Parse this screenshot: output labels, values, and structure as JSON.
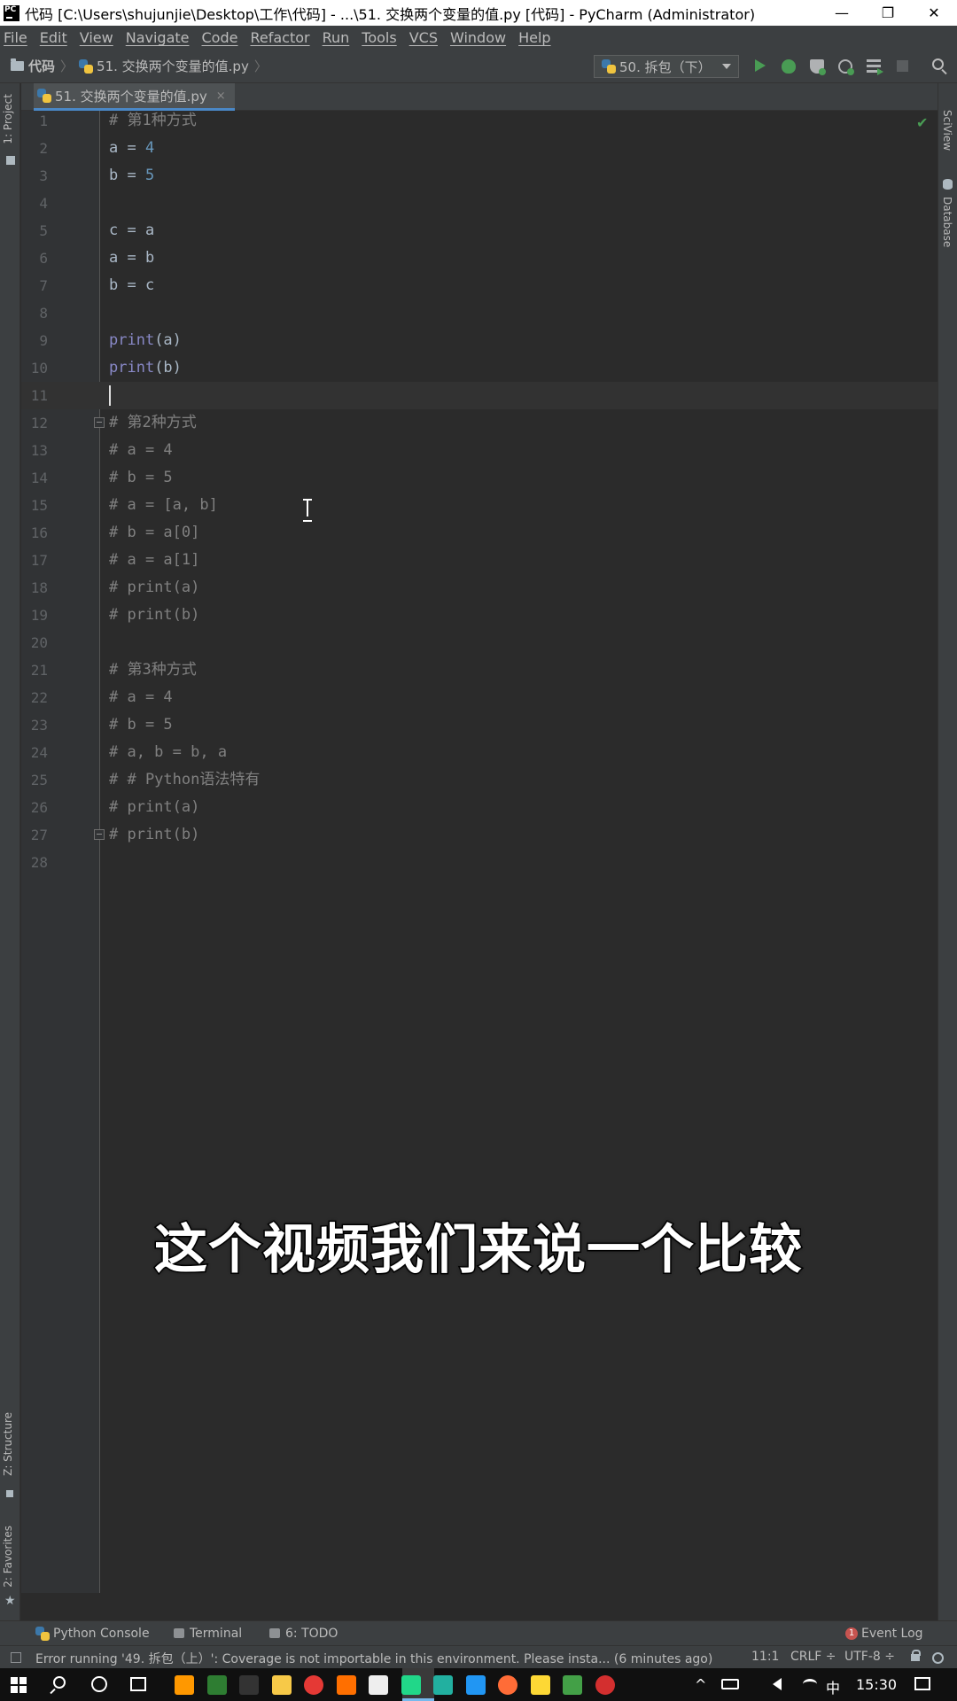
{
  "window": {
    "title": "代码 [C:\\Users\\shujunjie\\Desktop\\工作\\代码] - ...\\51. 交换两个变量的值.py [代码] - PyCharm (Administrator)",
    "app_icon_text": "PC",
    "minimize": "—",
    "restore": "❐",
    "close": "✕"
  },
  "menu": [
    "File",
    "Edit",
    "View",
    "Navigate",
    "Code",
    "Refactor",
    "Run",
    "Tools",
    "VCS",
    "Window",
    "Help"
  ],
  "navbar": {
    "project": "代码",
    "separator": "〉",
    "file": "51. 交换两个变量的值.py",
    "end": "〉",
    "run_config": "50. 拆包（下）"
  },
  "left_tools": {
    "project": "1: Project",
    "structure": "Z: Structure",
    "favorites": "2: Favorites"
  },
  "right_tools": {
    "sciview": "SciView",
    "database": "Database"
  },
  "tab": {
    "label": "51. 交换两个变量的值.py",
    "close": "×"
  },
  "code_lines": [
    {
      "n": "1",
      "tokens": [
        {
          "t": "# 第1种方式",
          "c": "comment"
        }
      ]
    },
    {
      "n": "2",
      "tokens": [
        {
          "t": "a = ",
          "c": "plain"
        },
        {
          "t": "4",
          "c": "num"
        }
      ]
    },
    {
      "n": "3",
      "tokens": [
        {
          "t": "b = ",
          "c": "plain"
        },
        {
          "t": "5",
          "c": "num"
        }
      ]
    },
    {
      "n": "4",
      "tokens": []
    },
    {
      "n": "5",
      "tokens": [
        {
          "t": "c = a",
          "c": "plain"
        }
      ]
    },
    {
      "n": "6",
      "tokens": [
        {
          "t": "a = b",
          "c": "plain"
        }
      ]
    },
    {
      "n": "7",
      "tokens": [
        {
          "t": "b = c",
          "c": "plain"
        }
      ]
    },
    {
      "n": "8",
      "tokens": []
    },
    {
      "n": "9",
      "tokens": [
        {
          "t": "print",
          "c": "builtin"
        },
        {
          "t": "(a)",
          "c": "plain"
        }
      ]
    },
    {
      "n": "10",
      "tokens": [
        {
          "t": "print",
          "c": "builtin"
        },
        {
          "t": "(b)",
          "c": "plain"
        }
      ]
    },
    {
      "n": "11",
      "tokens": []
    },
    {
      "n": "12",
      "tokens": [
        {
          "t": "# 第2种方式",
          "c": "comment"
        }
      ]
    },
    {
      "n": "13",
      "tokens": [
        {
          "t": "# a = 4",
          "c": "comment"
        }
      ]
    },
    {
      "n": "14",
      "tokens": [
        {
          "t": "# b = 5",
          "c": "comment"
        }
      ]
    },
    {
      "n": "15",
      "tokens": [
        {
          "t": "# a = [a, b]",
          "c": "comment"
        }
      ]
    },
    {
      "n": "16",
      "tokens": [
        {
          "t": "# b = a[0]",
          "c": "comment"
        }
      ]
    },
    {
      "n": "17",
      "tokens": [
        {
          "t": "# a = a[1]",
          "c": "comment"
        }
      ]
    },
    {
      "n": "18",
      "tokens": [
        {
          "t": "# print(a)",
          "c": "comment"
        }
      ]
    },
    {
      "n": "19",
      "tokens": [
        {
          "t": "# print(b)",
          "c": "comment"
        }
      ]
    },
    {
      "n": "20",
      "tokens": []
    },
    {
      "n": "21",
      "tokens": [
        {
          "t": "# 第3种方式",
          "c": "comment"
        }
      ]
    },
    {
      "n": "22",
      "tokens": [
        {
          "t": "# a = 4",
          "c": "comment"
        }
      ]
    },
    {
      "n": "23",
      "tokens": [
        {
          "t": "# b = 5",
          "c": "comment"
        }
      ]
    },
    {
      "n": "24",
      "tokens": [
        {
          "t": "# a, b = b, a",
          "c": "comment"
        }
      ]
    },
    {
      "n": "25",
      "tokens": [
        {
          "t": "# # Python语法特有",
          "c": "comment"
        }
      ]
    },
    {
      "n": "26",
      "tokens": [
        {
          "t": "# print(a)",
          "c": "comment"
        }
      ]
    },
    {
      "n": "27",
      "tokens": [
        {
          "t": "# print(b)",
          "c": "comment"
        }
      ]
    },
    {
      "n": "28",
      "tokens": []
    }
  ],
  "subtitle": "这个视频我们来说一个比较",
  "bottom_tools": {
    "console": "Python Console",
    "terminal": "Terminal",
    "todo": "6: TODO",
    "event_log": "Event Log",
    "event_count": "1"
  },
  "status": {
    "message": "Error running '49. 拆包（上）': Coverage is not importable in this environment. Please insta... (6 minutes ago)",
    "position": "11:1",
    "line_sep": "CRLF ÷",
    "encoding": "UTF-8 ÷"
  },
  "taskbar": {
    "clock": "15:30",
    "ime": "中",
    "tray_chevron": "^",
    "apps": [
      {
        "name": "sublime-icon",
        "color": "#ff9800"
      },
      {
        "name": "git-icon",
        "color": "#2e7d32"
      },
      {
        "name": "cmd-icon",
        "color": "#333333"
      },
      {
        "name": "note-icon",
        "color": "#f7c948"
      },
      {
        "name": "music-icon",
        "color": "#e53935"
      },
      {
        "name": "sublime2-icon",
        "color": "#ff6f00"
      },
      {
        "name": "typora-icon",
        "color": "#eeeeee"
      },
      {
        "name": "pycharm-icon",
        "color": "#21d789"
      },
      {
        "name": "clion-icon",
        "color": "#22b0a0"
      },
      {
        "name": "vscode-icon",
        "color": "#2196f3"
      },
      {
        "name": "postman-icon",
        "color": "#ff6c37"
      },
      {
        "name": "puzzle-icon",
        "color": "#fdd835"
      },
      {
        "name": "green-app-icon",
        "color": "#43a047"
      },
      {
        "name": "chrome-icon",
        "color": "#d32f2f"
      }
    ]
  }
}
